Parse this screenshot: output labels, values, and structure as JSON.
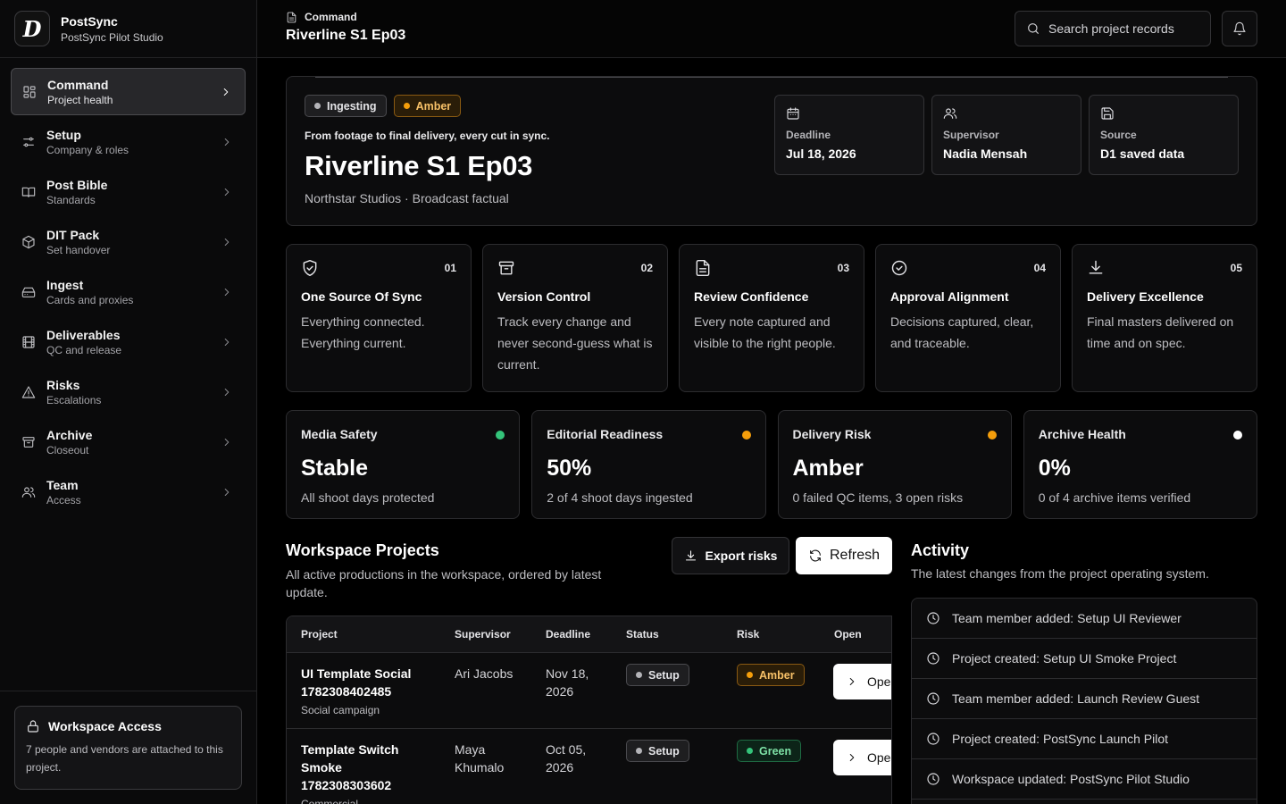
{
  "brand": {
    "logo_letter": "D",
    "name": "PostSync",
    "workspace": "PostSync Pilot Studio"
  },
  "sidebar": {
    "items": [
      {
        "label": "Command",
        "sub": "Project health",
        "icon": "dashboard-icon",
        "active": true
      },
      {
        "label": "Setup",
        "sub": "Company & roles",
        "icon": "sliders-icon"
      },
      {
        "label": "Post Bible",
        "sub": "Standards",
        "icon": "book-icon"
      },
      {
        "label": "DIT Pack",
        "sub": "Set handover",
        "icon": "package-icon"
      },
      {
        "label": "Ingest",
        "sub": "Cards and proxies",
        "icon": "drive-icon"
      },
      {
        "label": "Deliverables",
        "sub": "QC and release",
        "icon": "film-icon"
      },
      {
        "label": "Risks",
        "sub": "Escalations",
        "icon": "warning-icon"
      },
      {
        "label": "Archive",
        "sub": "Closeout",
        "icon": "archive-icon"
      },
      {
        "label": "Team",
        "sub": "Access",
        "icon": "users-icon"
      }
    ],
    "access": {
      "title": "Workspace Access",
      "text": "7 people and vendors are attached to this project."
    }
  },
  "topbar": {
    "crumb": "Command",
    "title": "Riverline S1 Ep03",
    "search_placeholder": "Search project records"
  },
  "hero": {
    "badges": [
      {
        "label": "Ingesting",
        "tone": "gray"
      },
      {
        "label": "Amber",
        "tone": "amber"
      }
    ],
    "tagline": "From footage to final delivery, every cut in sync.",
    "title": "Riverline S1 Ep03",
    "subtitle": "Northstar Studios · Broadcast factual",
    "meta": [
      {
        "label": "Deadline",
        "value": "Jul 18, 2026",
        "icon": "calendar-icon"
      },
      {
        "label": "Supervisor",
        "value": "Nadia Mensah",
        "icon": "users-icon"
      },
      {
        "label": "Source",
        "value": "D1 saved data",
        "icon": "save-icon"
      }
    ]
  },
  "pillars": [
    {
      "num": "01",
      "title": "One Source Of Sync",
      "text": "Everything connected. Everything current.",
      "icon": "shield-check-icon"
    },
    {
      "num": "02",
      "title": "Version Control",
      "text": "Track every change and never second-guess what is current.",
      "icon": "archive-icon"
    },
    {
      "num": "03",
      "title": "Review Confidence",
      "text": "Every note captured and visible to the right people.",
      "icon": "document-icon"
    },
    {
      "num": "04",
      "title": "Approval Alignment",
      "text": "Decisions captured, clear, and traceable.",
      "icon": "check-circle-icon"
    },
    {
      "num": "05",
      "title": "Delivery Excellence",
      "text": "Final masters delivered on time and on spec.",
      "icon": "download-icon"
    }
  ],
  "stats": [
    {
      "title": "Media Safety",
      "value": "Stable",
      "sub": "All shoot days protected",
      "color": "#34c47a"
    },
    {
      "title": "Editorial Readiness",
      "value": "50%",
      "sub": "2 of 4 shoot days ingested",
      "color": "#f59e0b"
    },
    {
      "title": "Delivery Risk",
      "value": "Amber",
      "sub": "0 failed QC items, 3 open risks",
      "color": "#f59e0b"
    },
    {
      "title": "Archive Health",
      "value": "0%",
      "sub": "0 of 4 archive items verified",
      "color": "#ffffff"
    }
  ],
  "projects": {
    "title": "Workspace Projects",
    "subtitle": "All active productions in the workspace, ordered by latest update.",
    "export_label": "Export risks",
    "refresh_label": "Refresh",
    "columns": [
      "Project",
      "Supervisor",
      "Deadline",
      "Status",
      "Risk",
      "Open"
    ],
    "rows": [
      {
        "name": "UI Template Social 1782308402485",
        "type": "Social campaign",
        "supervisor": "Ari Jacobs",
        "deadline": "Nov 18, 2026",
        "status": "Setup",
        "risk": "Amber",
        "risk_tone": "amber",
        "open_label": "Open"
      },
      {
        "name": "Template Switch Smoke 1782308303602",
        "type": "Commercial",
        "supervisor": "Maya Khumalo",
        "deadline": "Oct 05, 2026",
        "status": "Setup",
        "risk": "Green",
        "risk_tone": "green",
        "open_label": "Open"
      }
    ]
  },
  "activity": {
    "title": "Activity",
    "subtitle": "The latest changes from the project operating system.",
    "items": [
      "Team member added: Setup UI Reviewer",
      "Project created: Setup UI Smoke Project",
      "Team member added: Launch Review Guest",
      "Project created: PostSync Launch Pilot",
      "Workspace updated: PostSync Pilot Studio"
    ]
  }
}
